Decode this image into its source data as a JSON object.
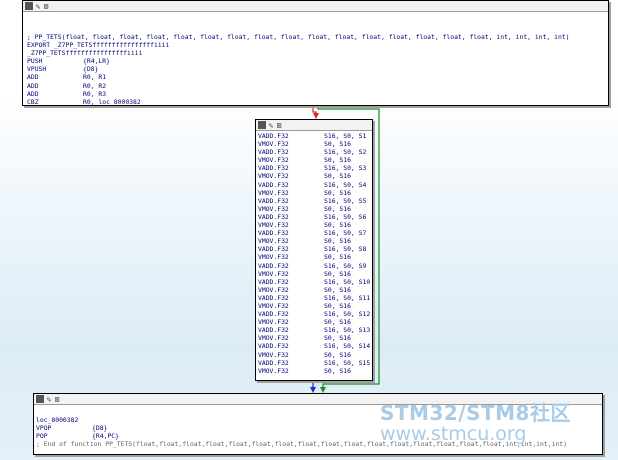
{
  "node1": {
    "lines": [
      {
        "type": "comment",
        "text": "; PP_TETS(float, float, float, float, float, float, float, float, float, float, float, float, float, float, float, float, int, int, int, int)"
      },
      {
        "type": "label",
        "text": "EXPORT _Z7PP_TETSffffffffffffffffiiii"
      },
      {
        "type": "label",
        "text": "_Z7PP_TETSffffffffffffffffiiii"
      },
      {
        "type": "ins",
        "mnemonic": "PUSH",
        "operands": "{R4,LR}"
      },
      {
        "type": "ins",
        "mnemonic": "VPUSH",
        "operands": "{D8}"
      },
      {
        "type": "ins",
        "mnemonic": "ADD",
        "operands": "R0, R1"
      },
      {
        "type": "ins",
        "mnemonic": "ADD",
        "operands": "R0, R2"
      },
      {
        "type": "ins",
        "mnemonic": "ADD",
        "operands": "R0, R3"
      },
      {
        "type": "ins",
        "mnemonic": "CBZ",
        "operands": "R0, loc_8000382"
      }
    ]
  },
  "node2": {
    "lines": [
      {
        "mnemonic": "VADD.F32",
        "operands": "S16, S0, S1"
      },
      {
        "mnemonic": "VMOV.F32",
        "operands": "S0, S16"
      },
      {
        "mnemonic": "VADD.F32",
        "operands": "S16, S0, S2"
      },
      {
        "mnemonic": "VMOV.F32",
        "operands": "S0, S16"
      },
      {
        "mnemonic": "VADD.F32",
        "operands": "S16, S0, S3"
      },
      {
        "mnemonic": "VMOV.F32",
        "operands": "S0, S16"
      },
      {
        "mnemonic": "VADD.F32",
        "operands": "S16, S0, S4"
      },
      {
        "mnemonic": "VMOV.F32",
        "operands": "S0, S16"
      },
      {
        "mnemonic": "VADD.F32",
        "operands": "S16, S0, S5"
      },
      {
        "mnemonic": "VMOV.F32",
        "operands": "S0, S16"
      },
      {
        "mnemonic": "VADD.F32",
        "operands": "S16, S0, S6"
      },
      {
        "mnemonic": "VMOV.F32",
        "operands": "S0, S16"
      },
      {
        "mnemonic": "VADD.F32",
        "operands": "S16, S0, S7"
      },
      {
        "mnemonic": "VMOV.F32",
        "operands": "S0, S16"
      },
      {
        "mnemonic": "VADD.F32",
        "operands": "S16, S0, S8"
      },
      {
        "mnemonic": "VMOV.F32",
        "operands": "S0, S16"
      },
      {
        "mnemonic": "VADD.F32",
        "operands": "S16, S0, S9"
      },
      {
        "mnemonic": "VMOV.F32",
        "operands": "S0, S16"
      },
      {
        "mnemonic": "VADD.F32",
        "operands": "S16, S0, S10"
      },
      {
        "mnemonic": "VMOV.F32",
        "operands": "S0, S16"
      },
      {
        "mnemonic": "VADD.F32",
        "operands": "S16, S0, S11"
      },
      {
        "mnemonic": "VMOV.F32",
        "operands": "S0, S16"
      },
      {
        "mnemonic": "VADD.F32",
        "operands": "S16, S0, S12"
      },
      {
        "mnemonic": "VMOV.F32",
        "operands": "S0, S16"
      },
      {
        "mnemonic": "VADD.F32",
        "operands": "S16, S0, S13"
      },
      {
        "mnemonic": "VMOV.F32",
        "operands": "S0, S16"
      },
      {
        "mnemonic": "VADD.F32",
        "operands": "S16, S0, S14"
      },
      {
        "mnemonic": "VMOV.F32",
        "operands": "S0, S16"
      },
      {
        "mnemonic": "VADD.F32",
        "operands": "S16, S0, S15"
      },
      {
        "mnemonic": "VMOV.F32",
        "operands": "S0, S16"
      }
    ]
  },
  "node3": {
    "lines": [
      {
        "type": "label",
        "text": "loc_8000382"
      },
      {
        "type": "ins",
        "mnemonic": "VPOP",
        "operands": "{D8}"
      },
      {
        "type": "ins",
        "mnemonic": "POP",
        "operands": "{R4,PC}"
      },
      {
        "type": "comment",
        "text": "; End of function PP_TETS(float,float,float,float,float,float,float,float,float,float,float,float,float,float,float,float,int,int,int,int)"
      }
    ]
  },
  "edge_colors": {
    "false_branch": "#d42a1a",
    "true_branch": "#1f8a1f",
    "fallthrough": "#1a2ed4"
  },
  "watermark": {
    "line1": "STM32/STM8社区",
    "line2": "www.stmcu.org"
  }
}
